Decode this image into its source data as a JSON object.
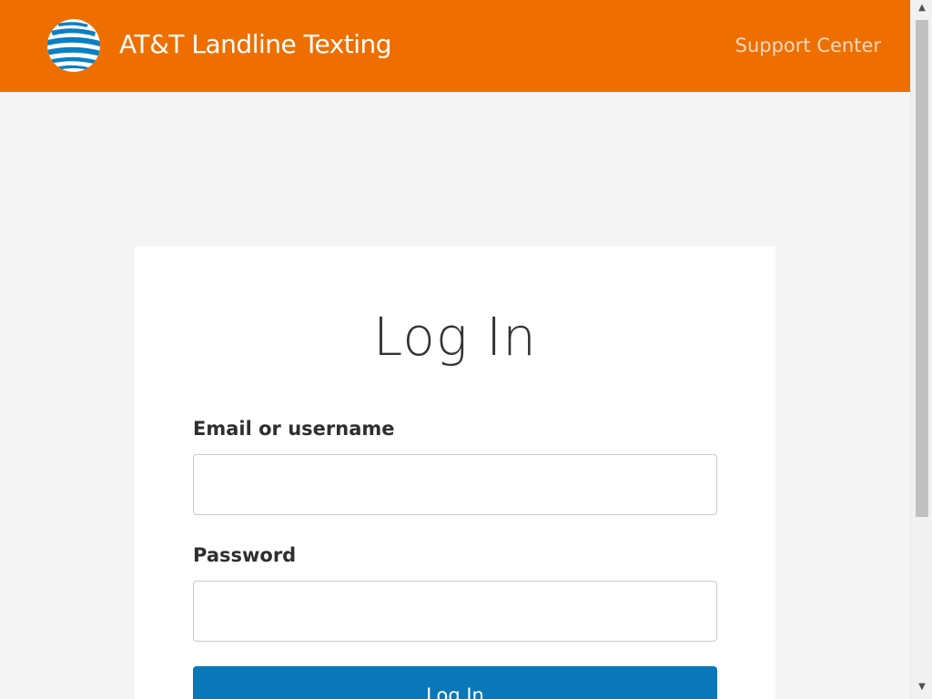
{
  "header": {
    "brand": "AT&T Landline Texting",
    "support_link": "Support Center",
    "logo_icon": "att-globe-logo",
    "background_color": "#ee6f00"
  },
  "login": {
    "title": "Log In",
    "email_label": "Email or username",
    "email_value": "",
    "password_label": "Password",
    "password_value": "",
    "submit_label": "Log In",
    "button_color": "#0a78b8"
  },
  "scrollbar": {
    "up_icon": "scroll-up-arrow",
    "down_icon": "scroll-down-arrow",
    "up_glyph": "▲",
    "down_glyph": "▼"
  }
}
